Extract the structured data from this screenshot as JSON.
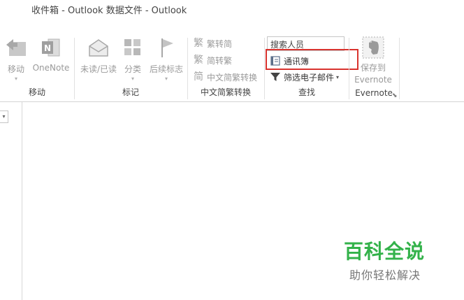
{
  "window": {
    "title": "收件箱 - Outlook 数据文件 - Outlook"
  },
  "ribbon": {
    "move_group": {
      "label": "移动",
      "move_label": "移动",
      "onenote_label": "OneNote"
    },
    "tags_group": {
      "label": "标记",
      "unread_label": "未读/已读",
      "categorize_label": "分类",
      "followup_label": "后续标志"
    },
    "chinese_group": {
      "label": "中文简繁转换",
      "to_simplified": "繁转简",
      "to_traditional": "简转繁",
      "conversion": "中文简繁转换"
    },
    "find_group": {
      "label": "查找",
      "search_people_text": "搜索人员",
      "address_book_label": "通讯簿",
      "filter_email_label": "筛选电子邮件"
    },
    "evernote_group": {
      "label": "Evernote",
      "save_line1": "保存到",
      "save_line2": "Evernote"
    }
  },
  "watermark": {
    "title": "百科全说",
    "subtitle": "助你轻松解决"
  },
  "colors": {
    "highlight": "#d9332e",
    "watermark_green": "#33b24a",
    "disabled_text": "#9a9a9a"
  }
}
